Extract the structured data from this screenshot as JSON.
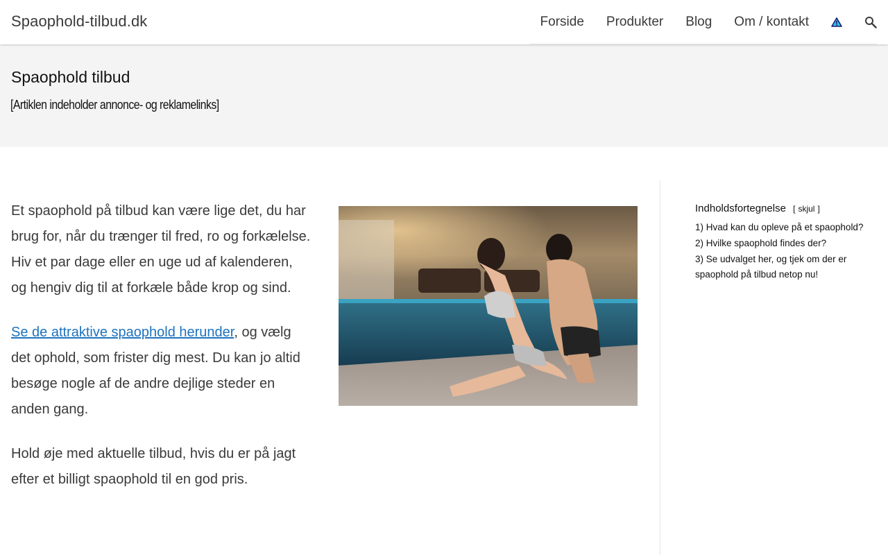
{
  "header": {
    "site_title": "Spaophold-tilbud.dk",
    "nav": [
      "Forside",
      "Produkter",
      "Blog",
      "Om / kontakt"
    ]
  },
  "hero": {
    "title": "Spaophold tilbud",
    "disclaimer": "[Artiklen indeholder annonce- og reklamelinks]"
  },
  "article": {
    "p1": "Et spaophold på tilbud kan være lige det, du har brug for, når du trænger til fred, ro og forkælelse. Hiv et par dage eller en uge ud af kalenderen, og hengiv dig til at forkæle både krop og sind.",
    "p2_link": "Se de attraktive spaophold herunder",
    "p2_rest": ", og vælg det ophold, som frister dig mest. Du kan jo altid besøge nogle af de andre dejlige steder en anden gang.",
    "p3": "Hold øje med aktuelle tilbud, hvis du er på jagt efter et billigt spaophold til en god pris."
  },
  "toc": {
    "title": "Indholdsfortegnelse",
    "toggle_open": "[",
    "toggle_label": "skjul",
    "toggle_close": "]",
    "items": [
      {
        "num": "1)",
        "text": "Hvad kan du opleve på et spaophold?"
      },
      {
        "num": "2)",
        "text": "Hvilke spaophold findes der?"
      },
      {
        "num": "3)",
        "text": "Se udvalget her, og tjek om der er spaophold på tilbud netop nu!"
      }
    ]
  },
  "icons": {
    "warning": "warning-triangle-icon",
    "search": "search-icon"
  },
  "colors": {
    "link": "#1e73be",
    "hero_bg": "#f4f4f4",
    "text": "#3a3a3a"
  }
}
